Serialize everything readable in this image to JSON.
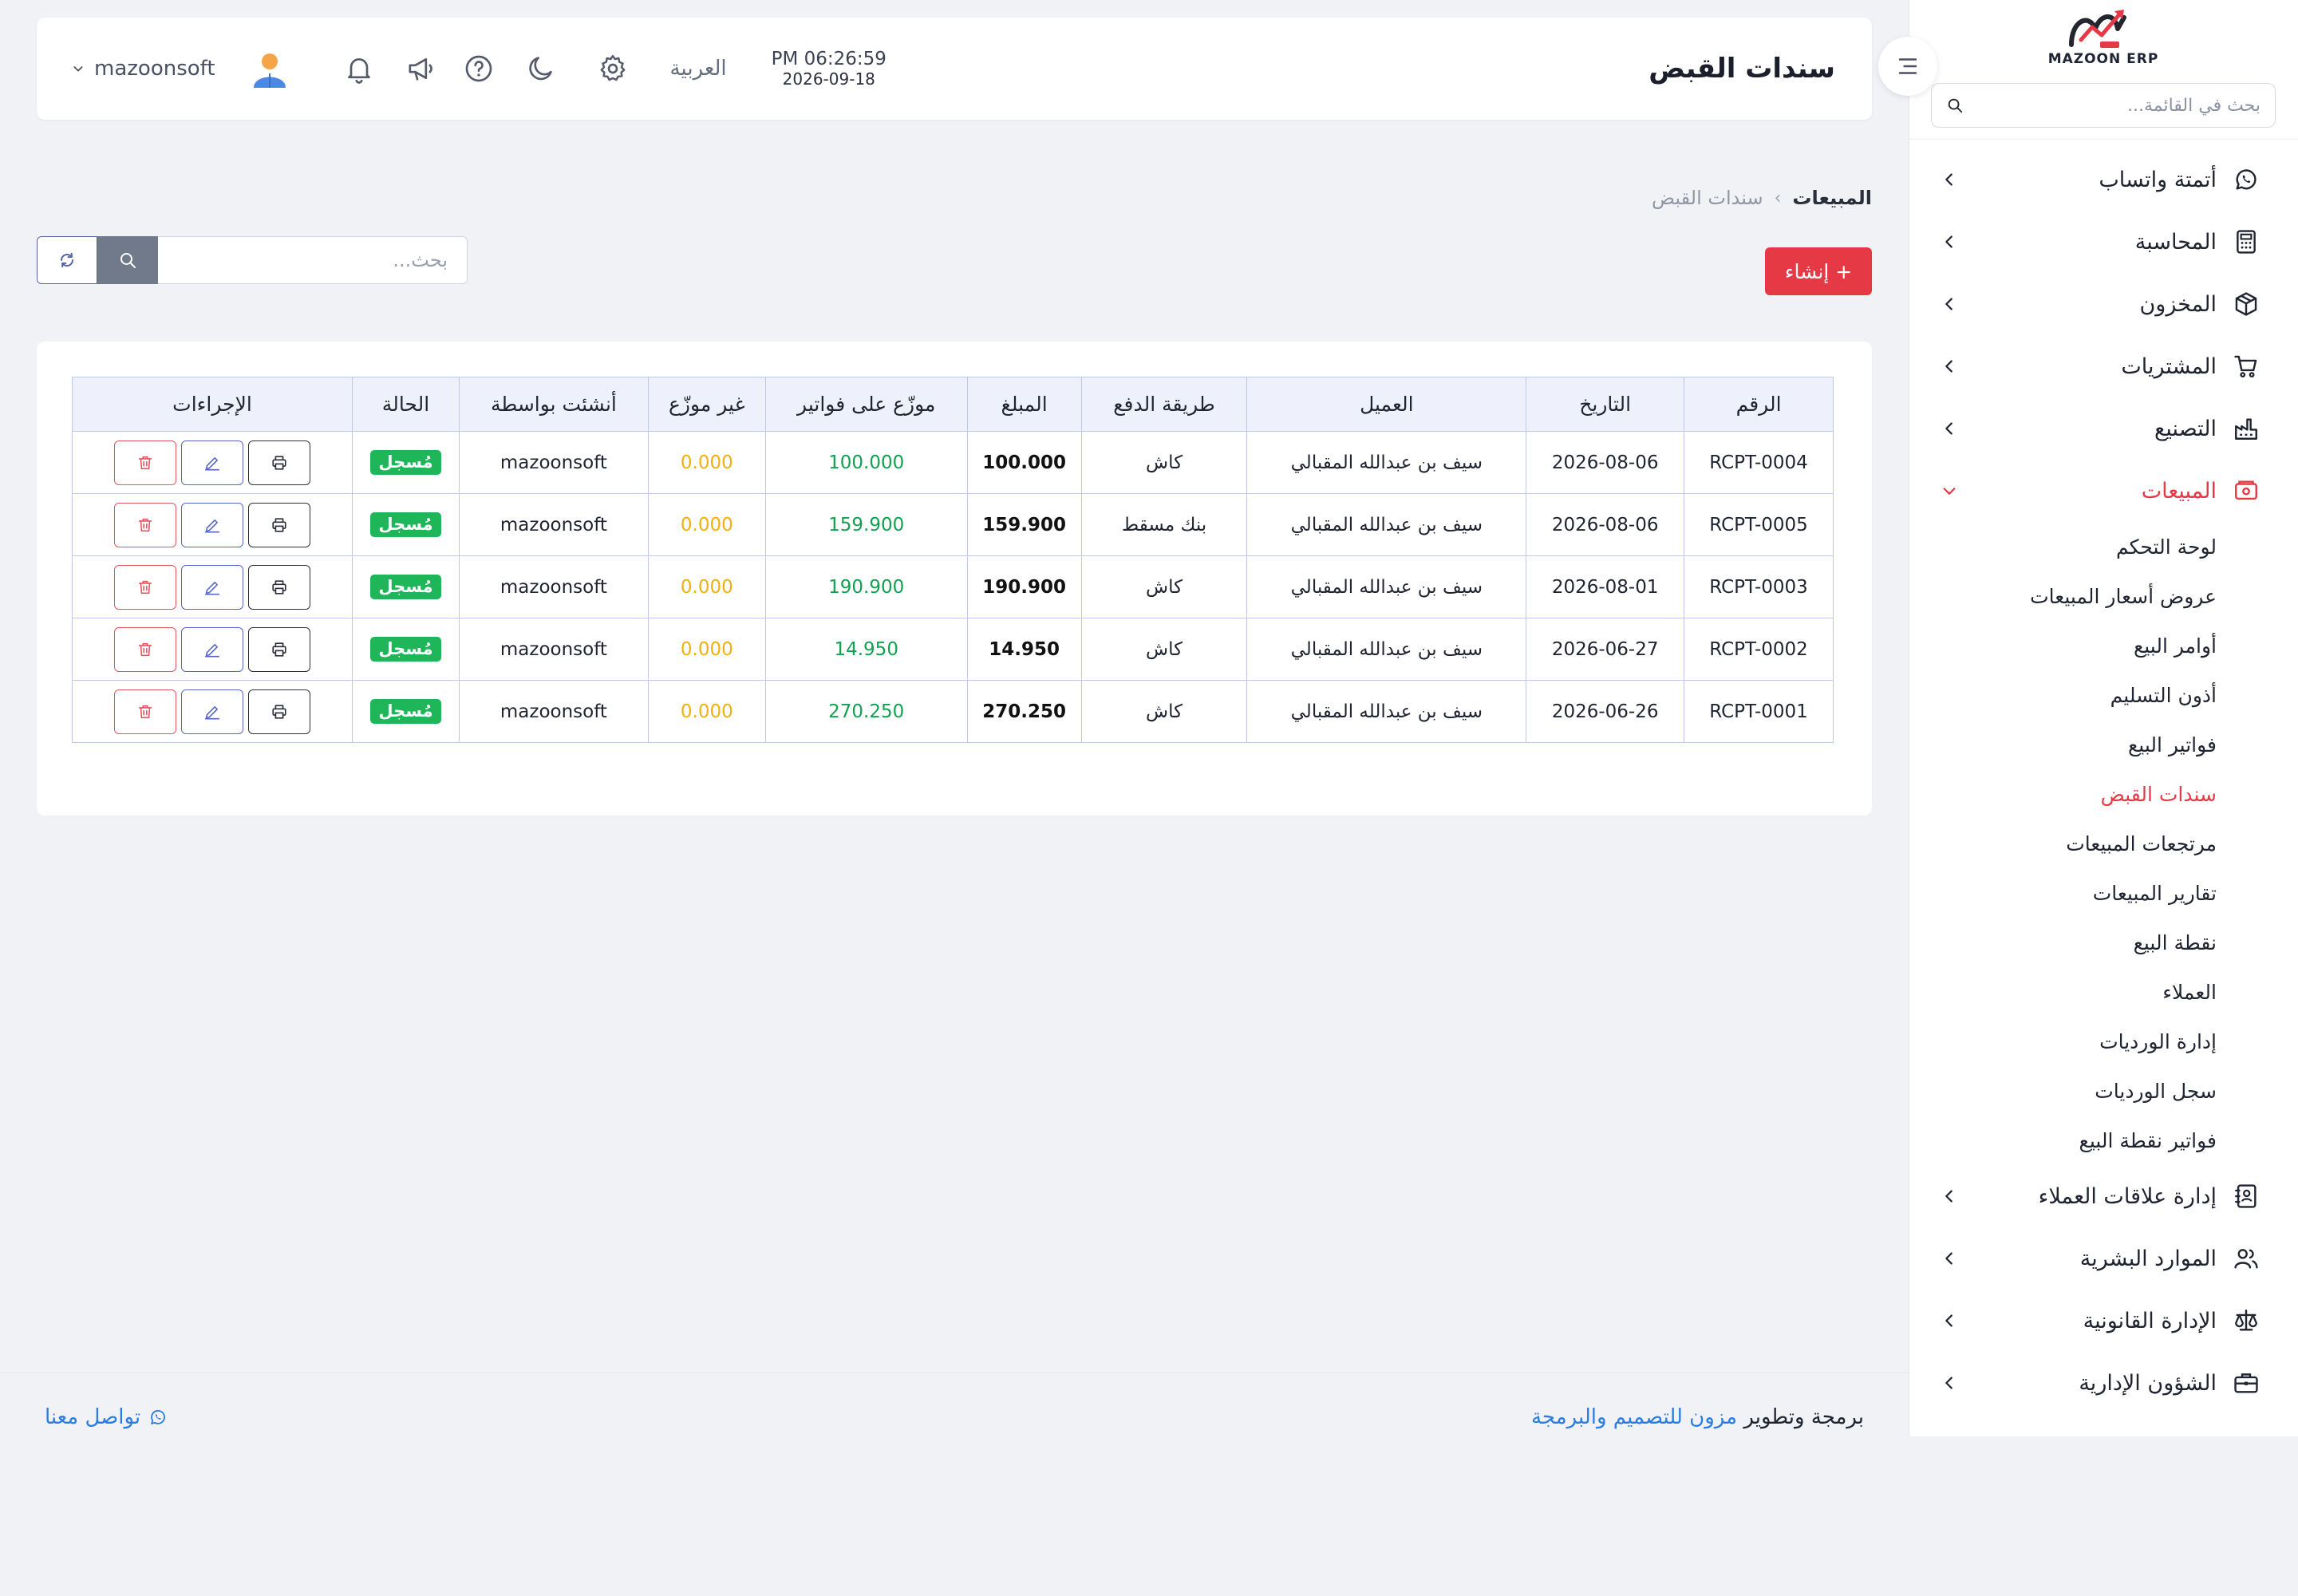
{
  "app": {
    "logo_text": "MAZOON ERP"
  },
  "colors": {
    "accent": "#e53946",
    "success": "#1fb65a",
    "link": "#2a7de1",
    "warning": "#f2b00f"
  },
  "sidebar": {
    "search_placeholder": "بحث في القائمة...",
    "items": [
      {
        "label": "أتمتة واتساب",
        "icon": "whatsapp-icon"
      },
      {
        "label": "المحاسبة",
        "icon": "calculator-icon"
      },
      {
        "label": "المخزون",
        "icon": "box-icon"
      },
      {
        "label": "المشتريات",
        "icon": "cart-icon"
      },
      {
        "label": "التصنيع",
        "icon": "factory-icon"
      },
      {
        "label": "المبيعات",
        "icon": "sales-icon",
        "expanded": true
      },
      {
        "label": "إدارة علاقات العملاء",
        "icon": "contacts-icon"
      },
      {
        "label": "الموارد البشرية",
        "icon": "users-icon"
      },
      {
        "label": "الإدارة القانونية",
        "icon": "scale-icon"
      },
      {
        "label": "الشؤون الإدارية",
        "icon": "briefcase-icon"
      }
    ],
    "sales_sub": [
      "لوحة التحكم",
      "عروض أسعار المبيعات",
      "أوامر البيع",
      "أذون التسليم",
      "فواتير البيع",
      "سندات القبض",
      "مرتجعات المبيعات",
      "تقارير المبيعات",
      "نقطة البيع",
      "العملاء",
      "إدارة الورديات",
      "سجل الورديات",
      "فواتير نقطة البيع"
    ],
    "active_sub": "سندات القبض"
  },
  "header": {
    "title": "سندات القبض",
    "language": "العربية",
    "time": "PM 06:26:59",
    "date": "2026-09-18",
    "user": "mazoonsoft"
  },
  "breadcrumb": {
    "root": "المبيعات",
    "sep": "›",
    "current": "سندات القبض"
  },
  "toolbar": {
    "create_label": "+ إنشاء",
    "search_placeholder": "بحث..."
  },
  "table": {
    "headers": [
      "الرقم",
      "التاريخ",
      "العميل",
      "طريقة الدفع",
      "المبلغ",
      "موزّع على فواتير",
      "غير موزّع",
      "أنشئت بواسطة",
      "الحالة",
      "الإجراءات"
    ],
    "rows": [
      {
        "number": "RCPT-0004",
        "date": "2026-08-06",
        "customer": "سيف بن عبدالله المقبالي",
        "method": "كاش",
        "amount": "100.000",
        "allocated": "100.000",
        "unallocated": "0.000",
        "created_by": "mazoonsoft",
        "status": "مُسجل"
      },
      {
        "number": "RCPT-0005",
        "date": "2026-08-06",
        "customer": "سيف بن عبدالله المقبالي",
        "method": "بنك مسقط",
        "amount": "159.900",
        "allocated": "159.900",
        "unallocated": "0.000",
        "created_by": "mazoonsoft",
        "status": "مُسجل"
      },
      {
        "number": "RCPT-0003",
        "date": "2026-08-01",
        "customer": "سيف بن عبدالله المقبالي",
        "method": "كاش",
        "amount": "190.900",
        "allocated": "190.900",
        "unallocated": "0.000",
        "created_by": "mazoonsoft",
        "status": "مُسجل"
      },
      {
        "number": "RCPT-0002",
        "date": "2026-06-27",
        "customer": "سيف بن عبدالله المقبالي",
        "method": "كاش",
        "amount": "14.950",
        "allocated": "14.950",
        "unallocated": "0.000",
        "created_by": "mazoonsoft",
        "status": "مُسجل"
      },
      {
        "number": "RCPT-0001",
        "date": "2026-06-26",
        "customer": "سيف بن عبدالله المقبالي",
        "method": "كاش",
        "amount": "270.250",
        "allocated": "270.250",
        "unallocated": "0.000",
        "created_by": "mazoonsoft",
        "status": "مُسجل"
      }
    ]
  },
  "footer": {
    "credit_prefix": "برمجة وتطوير",
    "credit_brand": "مزون للتصميم والبرمجة",
    "contact": "تواصل معنا"
  }
}
